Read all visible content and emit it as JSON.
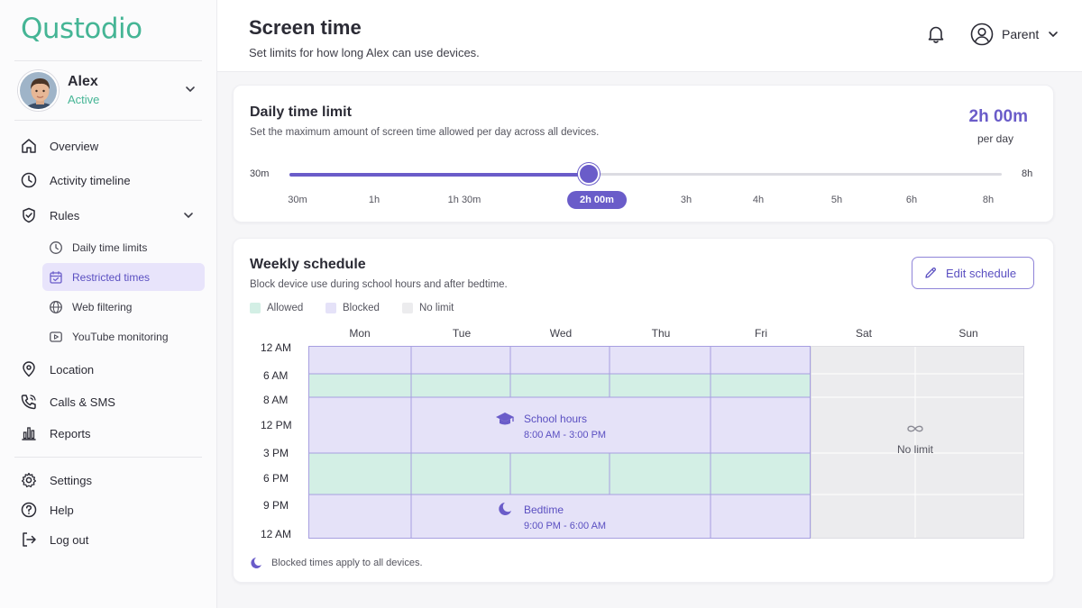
{
  "app": {
    "logo": "Qustodio"
  },
  "profile": {
    "name": "Alex",
    "status": "Active"
  },
  "nav": {
    "overview": "Overview",
    "activity": "Activity timeline",
    "rules": "Rules",
    "rules_sub": {
      "daily": "Daily time limits",
      "restricted": "Restricted times",
      "web": "Web filtering",
      "youtube": "YouTube monitoring"
    },
    "location": "Location",
    "calls": "Calls & SMS",
    "reports": "Reports",
    "settings": "Settings",
    "help": "Help",
    "logout": "Log out"
  },
  "header": {
    "title": "Screen time",
    "subtitle": "Set limits for how long Alex can use devices.",
    "account": "Parent"
  },
  "daily_limit": {
    "title": "Daily time limit",
    "subtitle": "Set the maximum amount of screen time allowed per day across all devices.",
    "value": "2h 00m",
    "unit": "per day",
    "min_label": "30m",
    "max_label": "8h",
    "ticks": [
      "30m",
      "1h",
      "1h 30m",
      "2h 00m",
      "3h",
      "4h",
      "5h",
      "6h",
      "8h"
    ],
    "selected_index": 3,
    "fill_fraction": 0.42
  },
  "weekly": {
    "title": "Weekly schedule",
    "subtitle": "Block device use during school hours and after bedtime.",
    "edit_label": "Edit schedule",
    "legend": {
      "allowed": "Allowed",
      "blocked": "Blocked",
      "no_limit": "No limit"
    },
    "days": [
      "Mon",
      "Tue",
      "Wed",
      "Thu",
      "Fri",
      "Sat",
      "Sun"
    ],
    "times": [
      "12 AM",
      "6 AM",
      "8 AM",
      "12 PM",
      "3 PM",
      "6 PM",
      "9 PM",
      "12 AM"
    ],
    "school": {
      "title": "School hours",
      "range": "8:00 AM - 3:00 PM"
    },
    "bedtime": {
      "title": "Bedtime",
      "range": "9:00 PM - 6:00 AM"
    },
    "weekend": {
      "label": "No limit"
    },
    "footnote": "Blocked times apply to all devices."
  },
  "colors": {
    "brand": "#45b595",
    "accent": "#6a5cc9",
    "allowed": "#d3efe5",
    "blocked": "#e5e2f8",
    "no_limit": "#ececee"
  }
}
